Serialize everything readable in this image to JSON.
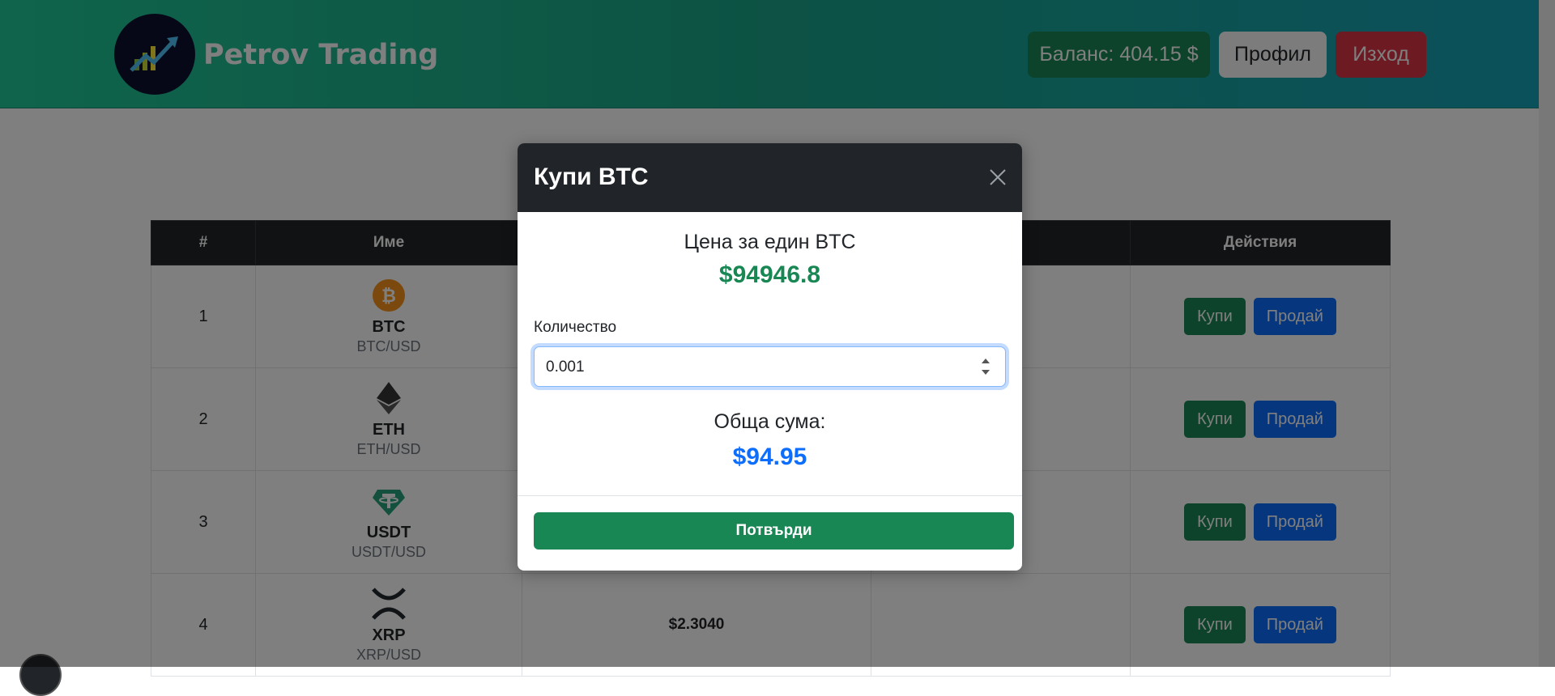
{
  "header": {
    "brand": "Petrov Trading",
    "balance_label": "Баланс: 404.15 $",
    "profile_label": "Профил",
    "logout_label": "Изход"
  },
  "table": {
    "columns": [
      "#",
      "Име",
      "",
      "",
      "Действия"
    ],
    "rows": [
      {
        "num": "1",
        "symbol": "BTC",
        "pair": "BTC/USD",
        "price": "",
        "icon": "bitcoin-icon",
        "buy": "Купи",
        "sell": "Продай"
      },
      {
        "num": "2",
        "symbol": "ETH",
        "pair": "ETH/USD",
        "price": "",
        "icon": "ethereum-icon",
        "buy": "Купи",
        "sell": "Продай"
      },
      {
        "num": "3",
        "symbol": "USDT",
        "pair": "USDT/USD",
        "price": "",
        "icon": "tether-icon",
        "buy": "Купи",
        "sell": "Продай"
      },
      {
        "num": "4",
        "symbol": "XRP",
        "pair": "XRP/USD",
        "price": "$2.3040",
        "icon": "xrp-icon",
        "buy": "Купи",
        "sell": "Продай"
      }
    ]
  },
  "modal": {
    "title": "Купи BTC",
    "price_label": "Цена за един BTC",
    "price_value": "$94946.8",
    "quantity_label": "Количество",
    "quantity_value": "0.001",
    "total_label": "Обща сума:",
    "total_value": "$94.95",
    "confirm_label": "Потвърди"
  },
  "colors": {
    "header_start": "#20c997",
    "header_end": "#17a2b8",
    "buy": "#198754",
    "sell": "#0d6efd",
    "logout": "#dc3545"
  }
}
